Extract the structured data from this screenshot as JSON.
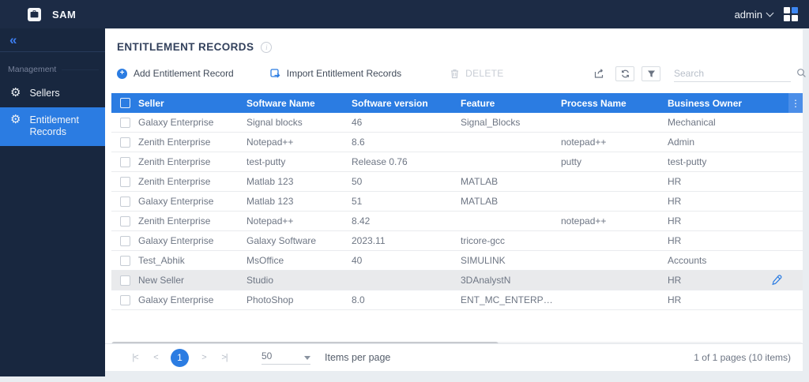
{
  "topbar": {
    "app_name": "SAM",
    "user_label": "admin"
  },
  "sidebar": {
    "collapse_glyph": "«",
    "section_label": "Management",
    "items": [
      {
        "label": "Sellers",
        "active": false
      },
      {
        "label": "Entitlement Records",
        "active": true
      }
    ]
  },
  "page": {
    "title": "ENTITLEMENT RECORDS",
    "info_glyph": "i"
  },
  "toolbar": {
    "add_label": "Add Entitlement Record",
    "add_glyph": "+",
    "import_label": "Import Entitlement Records",
    "delete_label": "DELETE",
    "search_placeholder": "Search"
  },
  "table": {
    "columns": [
      "Seller",
      "Software Name",
      "Software version",
      "Feature",
      "Process Name",
      "Business Owner"
    ],
    "menu_dots_glyph": "⋮",
    "rows": [
      {
        "seller": "Galaxy Enterprise",
        "software_name": "Signal blocks",
        "software_version": "46",
        "feature": "Signal_Blocks",
        "process_name": "",
        "business_owner": "Mechanical"
      },
      {
        "seller": "Zenith Enterprise",
        "software_name": "Notepad++",
        "software_version": "8.6",
        "feature": "",
        "process_name": "notepad++",
        "business_owner": "Admin"
      },
      {
        "seller": "Zenith Enterprise",
        "software_name": "test-putty",
        "software_version": "Release 0.76",
        "feature": "",
        "process_name": "putty",
        "business_owner": "test-putty"
      },
      {
        "seller": "Zenith Enterprise",
        "software_name": "Matlab 123",
        "software_version": "50",
        "feature": "MATLAB",
        "process_name": "",
        "business_owner": "HR"
      },
      {
        "seller": "Galaxy Enterprise",
        "software_name": "Matlab 123",
        "software_version": "51",
        "feature": "MATLAB",
        "process_name": "",
        "business_owner": "HR"
      },
      {
        "seller": "Zenith Enterprise",
        "software_name": "Notepad++",
        "software_version": "8.42",
        "feature": "",
        "process_name": "notepad++",
        "business_owner": "HR"
      },
      {
        "seller": "Galaxy Enterprise",
        "software_name": "Galaxy Software",
        "software_version": "2023.11",
        "feature": "tricore-gcc",
        "process_name": "",
        "business_owner": "HR"
      },
      {
        "seller": "Test_Abhik",
        "software_name": "MsOffice",
        "software_version": "40",
        "feature": "SIMULINK",
        "process_name": "",
        "business_owner": "Accounts"
      },
      {
        "seller": "New Seller",
        "software_name": "Studio",
        "software_version": "",
        "feature": "3DAnalystN",
        "process_name": "",
        "business_owner": "HR",
        "highlighted": true,
        "editable": true
      },
      {
        "seller": "Galaxy Enterprise",
        "software_name": "PhotoShop",
        "software_version": "8.0",
        "feature": "ENT_MC_ENTERPRISE_F...",
        "process_name": "",
        "business_owner": "HR"
      }
    ]
  },
  "pagination": {
    "first_glyph": "|<",
    "prev_glyph": "<",
    "current_page": "1",
    "next_glyph": ">",
    "last_glyph": ">|",
    "items_per_page": "50",
    "items_per_page_label": "Items per page",
    "summary": "1 of 1 pages (10 items)"
  },
  "colors": {
    "accent_blue": "#2b7ce2",
    "topbar_navy": "#1c2b45",
    "sidebar_navy": "#18273f",
    "header_dots_blue": "#4b8ee8",
    "highlight_row": "#e9eaec",
    "disabled_gray": "#c8cdd5"
  }
}
